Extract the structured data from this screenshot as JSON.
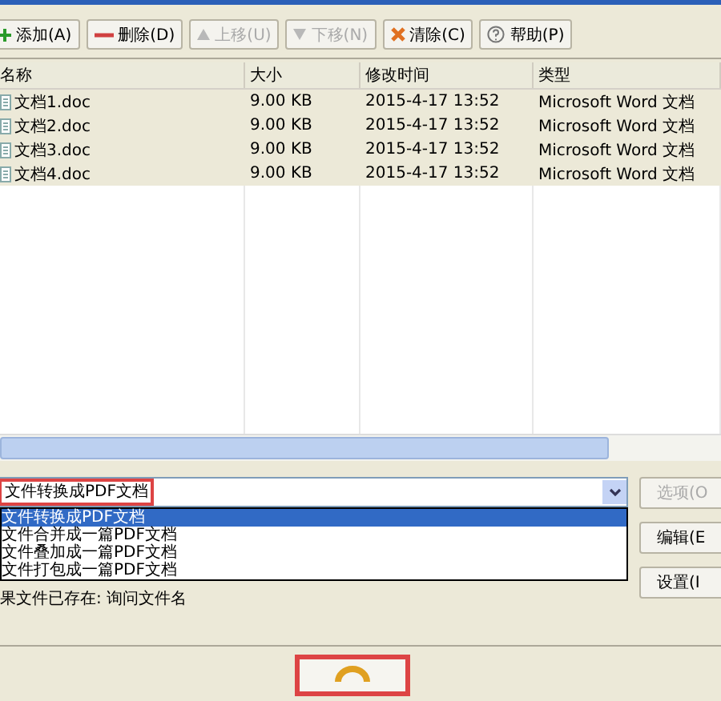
{
  "toolbar": [
    {
      "label": "添加(A)",
      "kind": "plus",
      "disabled": false
    },
    {
      "label": "删除(D)",
      "kind": "minus",
      "disabled": false
    },
    {
      "label": "上移(U)",
      "kind": "up",
      "disabled": true
    },
    {
      "label": "下移(N)",
      "kind": "down",
      "disabled": true
    },
    {
      "label": "清除(C)",
      "kind": "cross",
      "disabled": false
    },
    {
      "label": "帮助(P)",
      "kind": "help",
      "disabled": false
    }
  ],
  "table": {
    "columns": [
      "名称",
      "大小",
      "修改时间",
      "类型"
    ],
    "rows": [
      {
        "cells": [
          "文档1.doc",
          "9.00 KB",
          "2015-4-17 13:52",
          "Microsoft Word 文档"
        ],
        "selected": true
      },
      {
        "cells": [
          "文档2.doc",
          "9.00 KB",
          "2015-4-17 13:52",
          "Microsoft Word 文档"
        ],
        "selected": true
      },
      {
        "cells": [
          "文档3.doc",
          "9.00 KB",
          "2015-4-17 13:52",
          "Microsoft Word 文档"
        ],
        "selected": true
      },
      {
        "cells": [
          "文档4.doc",
          "9.00 KB",
          "2015-4-17 13:52",
          "Microsoft Word 文档"
        ],
        "selected": true
      }
    ]
  },
  "mode_select": {
    "value": "文件转换成PDF文档",
    "expanded": true,
    "options": [
      {
        "label": "文件转换成PDF文档",
        "selected": true
      },
      {
        "label": "文件合并成一篇PDF文档",
        "selected": false
      },
      {
        "label": "文件叠加成一篇PDF文档",
        "selected": false
      },
      {
        "label": "文件打包成一篇PDF文档",
        "selected": false
      }
    ]
  },
  "side_buttons": [
    {
      "label": "选项(O",
      "disabled": true
    },
    {
      "label": "编辑(E",
      "disabled": false
    },
    {
      "label": "设置(I",
      "disabled": false
    }
  ],
  "status": "果文件已存在: 询问文件名"
}
